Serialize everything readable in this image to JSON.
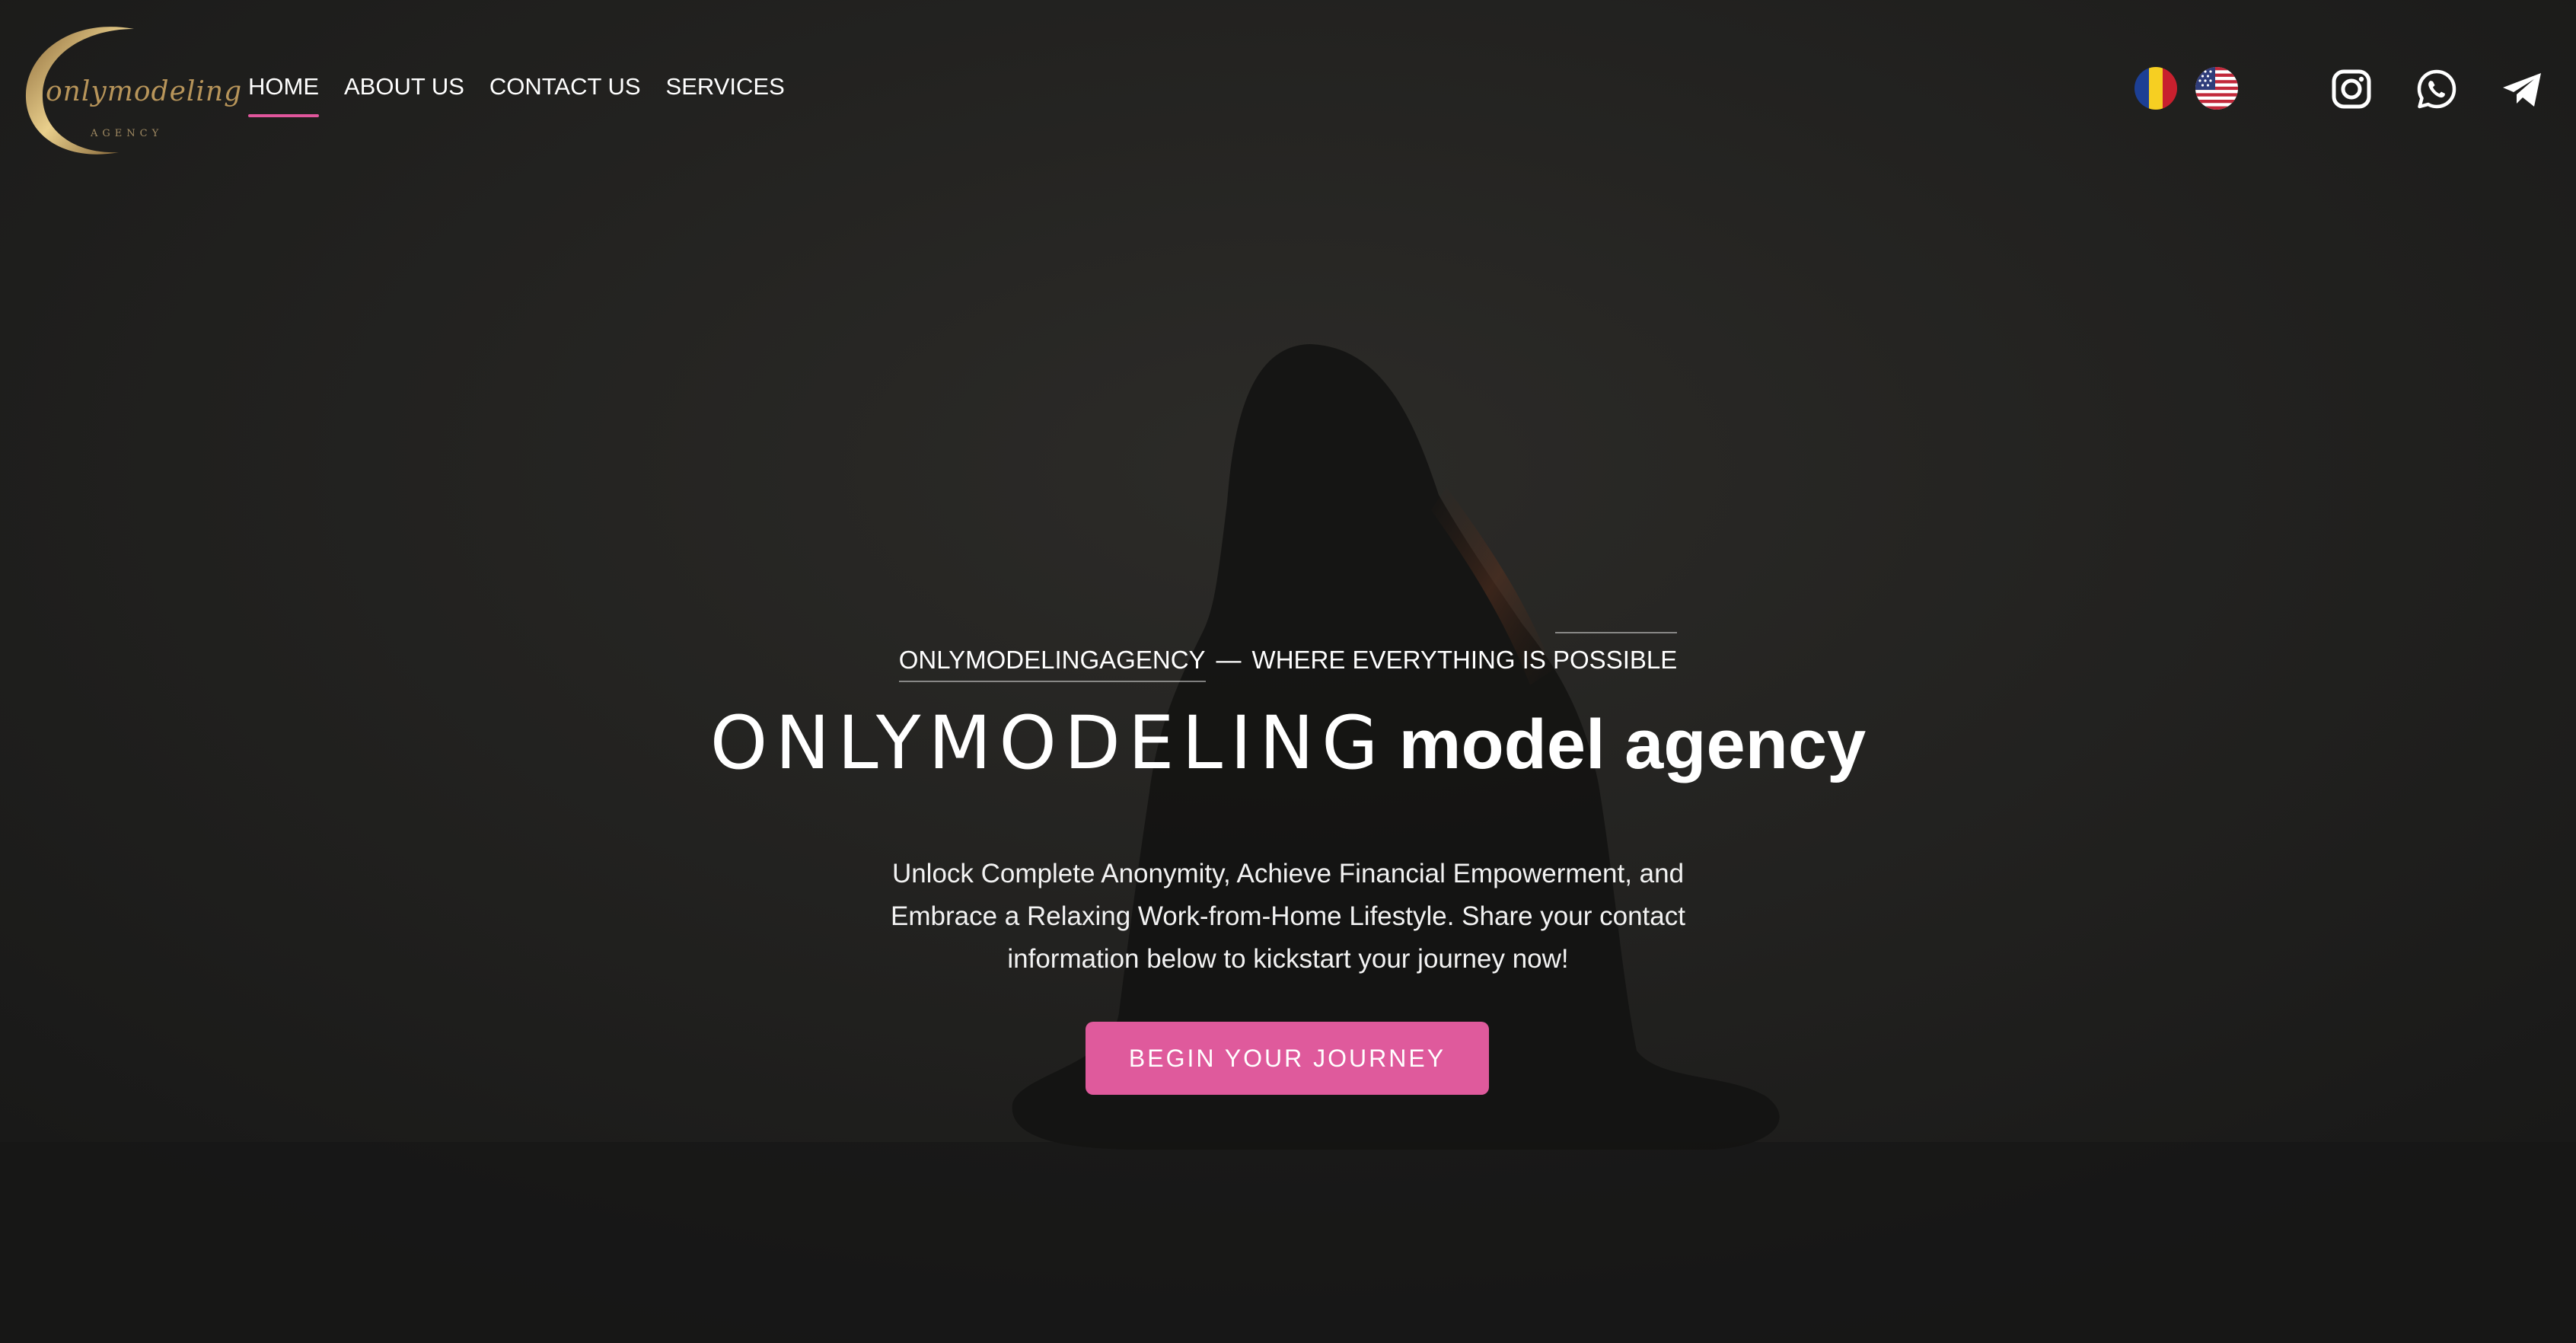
{
  "header": {
    "logo": {
      "script_text": "onlymodeling",
      "sub_text": "AGENCY"
    },
    "nav": [
      {
        "label": "HOME",
        "active": true
      },
      {
        "label": "ABOUT US",
        "active": false
      },
      {
        "label": "CONTACT US",
        "active": false
      },
      {
        "label": "SERVICES",
        "active": false
      }
    ],
    "languages": [
      {
        "icon": "romania-flag-icon"
      },
      {
        "icon": "usa-flag-icon"
      }
    ],
    "social": [
      {
        "icon": "instagram-icon"
      },
      {
        "icon": "whatsapp-icon"
      },
      {
        "icon": "telegram-icon"
      }
    ]
  },
  "hero": {
    "tagline_left": "ONLYMODELINGAGENCY",
    "tagline_separator": "—",
    "tagline_right": "WHERE EVERYTHING IS POSSIBLE",
    "headline_brand": "ONLYMODELING",
    "headline_tail": "model agency",
    "description": "Unlock Complete Anonymity, Achieve Financial Empowerment, and Embrace a Relaxing Work-from-Home Lifestyle. Share your contact information below to kickstart your journey now!",
    "cta_label": "BEGIN YOUR JOURNEY"
  },
  "colors": {
    "accent": "#df5a9c",
    "background": "#1d1d1c",
    "logo_gold": "#b8955a"
  }
}
